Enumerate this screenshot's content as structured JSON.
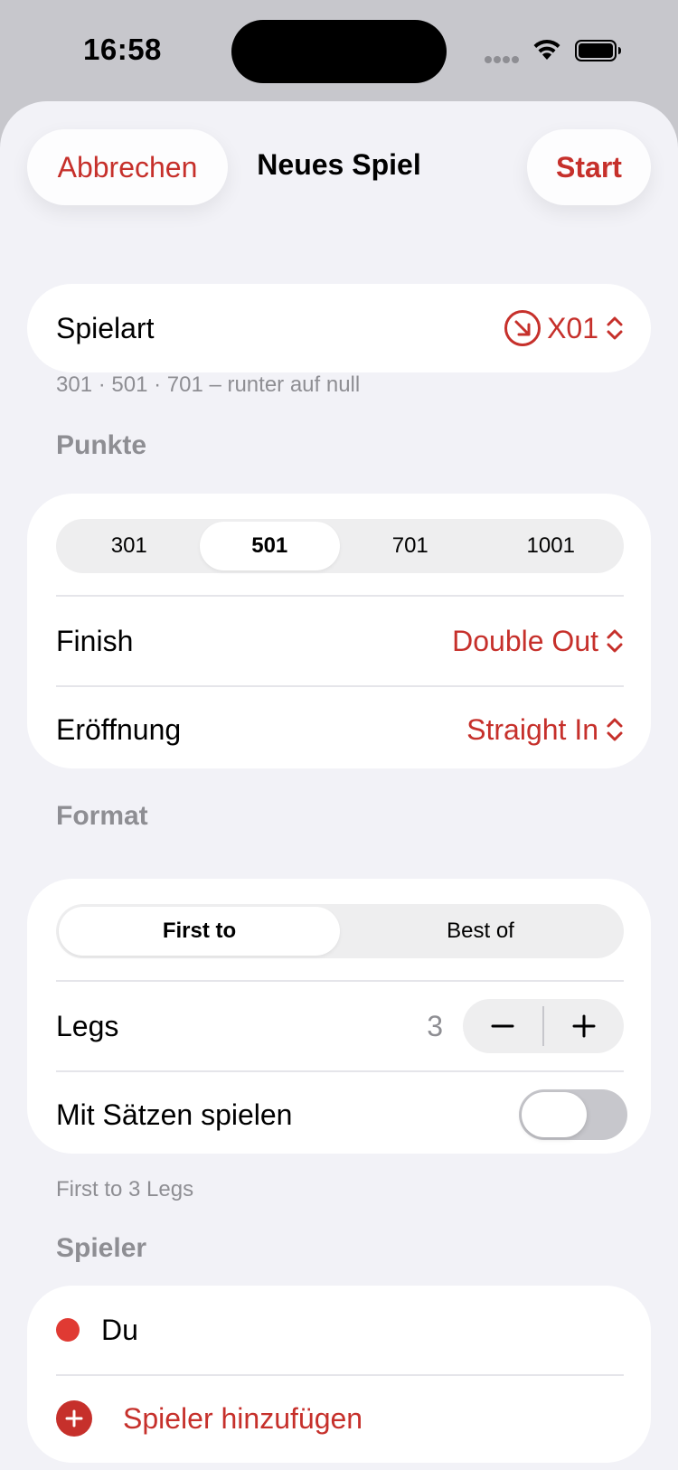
{
  "status_bar": {
    "time": "16:58"
  },
  "nav": {
    "cancel_label": "Abbrechen",
    "title": "Neues Spiel",
    "start_label": "Start"
  },
  "game_type": {
    "label": "Spielart",
    "value": "X01",
    "footnote": "301 · 501 · 701 – runter auf null"
  },
  "points": {
    "header": "Punkte",
    "options": [
      "301",
      "501",
      "701",
      "1001"
    ],
    "selected": "501",
    "finish_label": "Finish",
    "finish_value": "Double Out",
    "opening_label": "Eröffnung",
    "opening_value": "Straight In"
  },
  "format": {
    "header": "Format",
    "options": [
      "First to",
      "Best of"
    ],
    "selected": "First to",
    "legs_label": "Legs",
    "legs_value": "3",
    "sets_label": "Mit Sätzen spielen",
    "sets_enabled": false,
    "footnote": "First to 3 Legs"
  },
  "players": {
    "header": "Spieler",
    "list": [
      {
        "name": "Du",
        "color": "#e03a33"
      }
    ],
    "add_label": "Spieler hinzufügen"
  },
  "colors": {
    "accent": "#c6302b",
    "background": "#f2f2f7"
  }
}
